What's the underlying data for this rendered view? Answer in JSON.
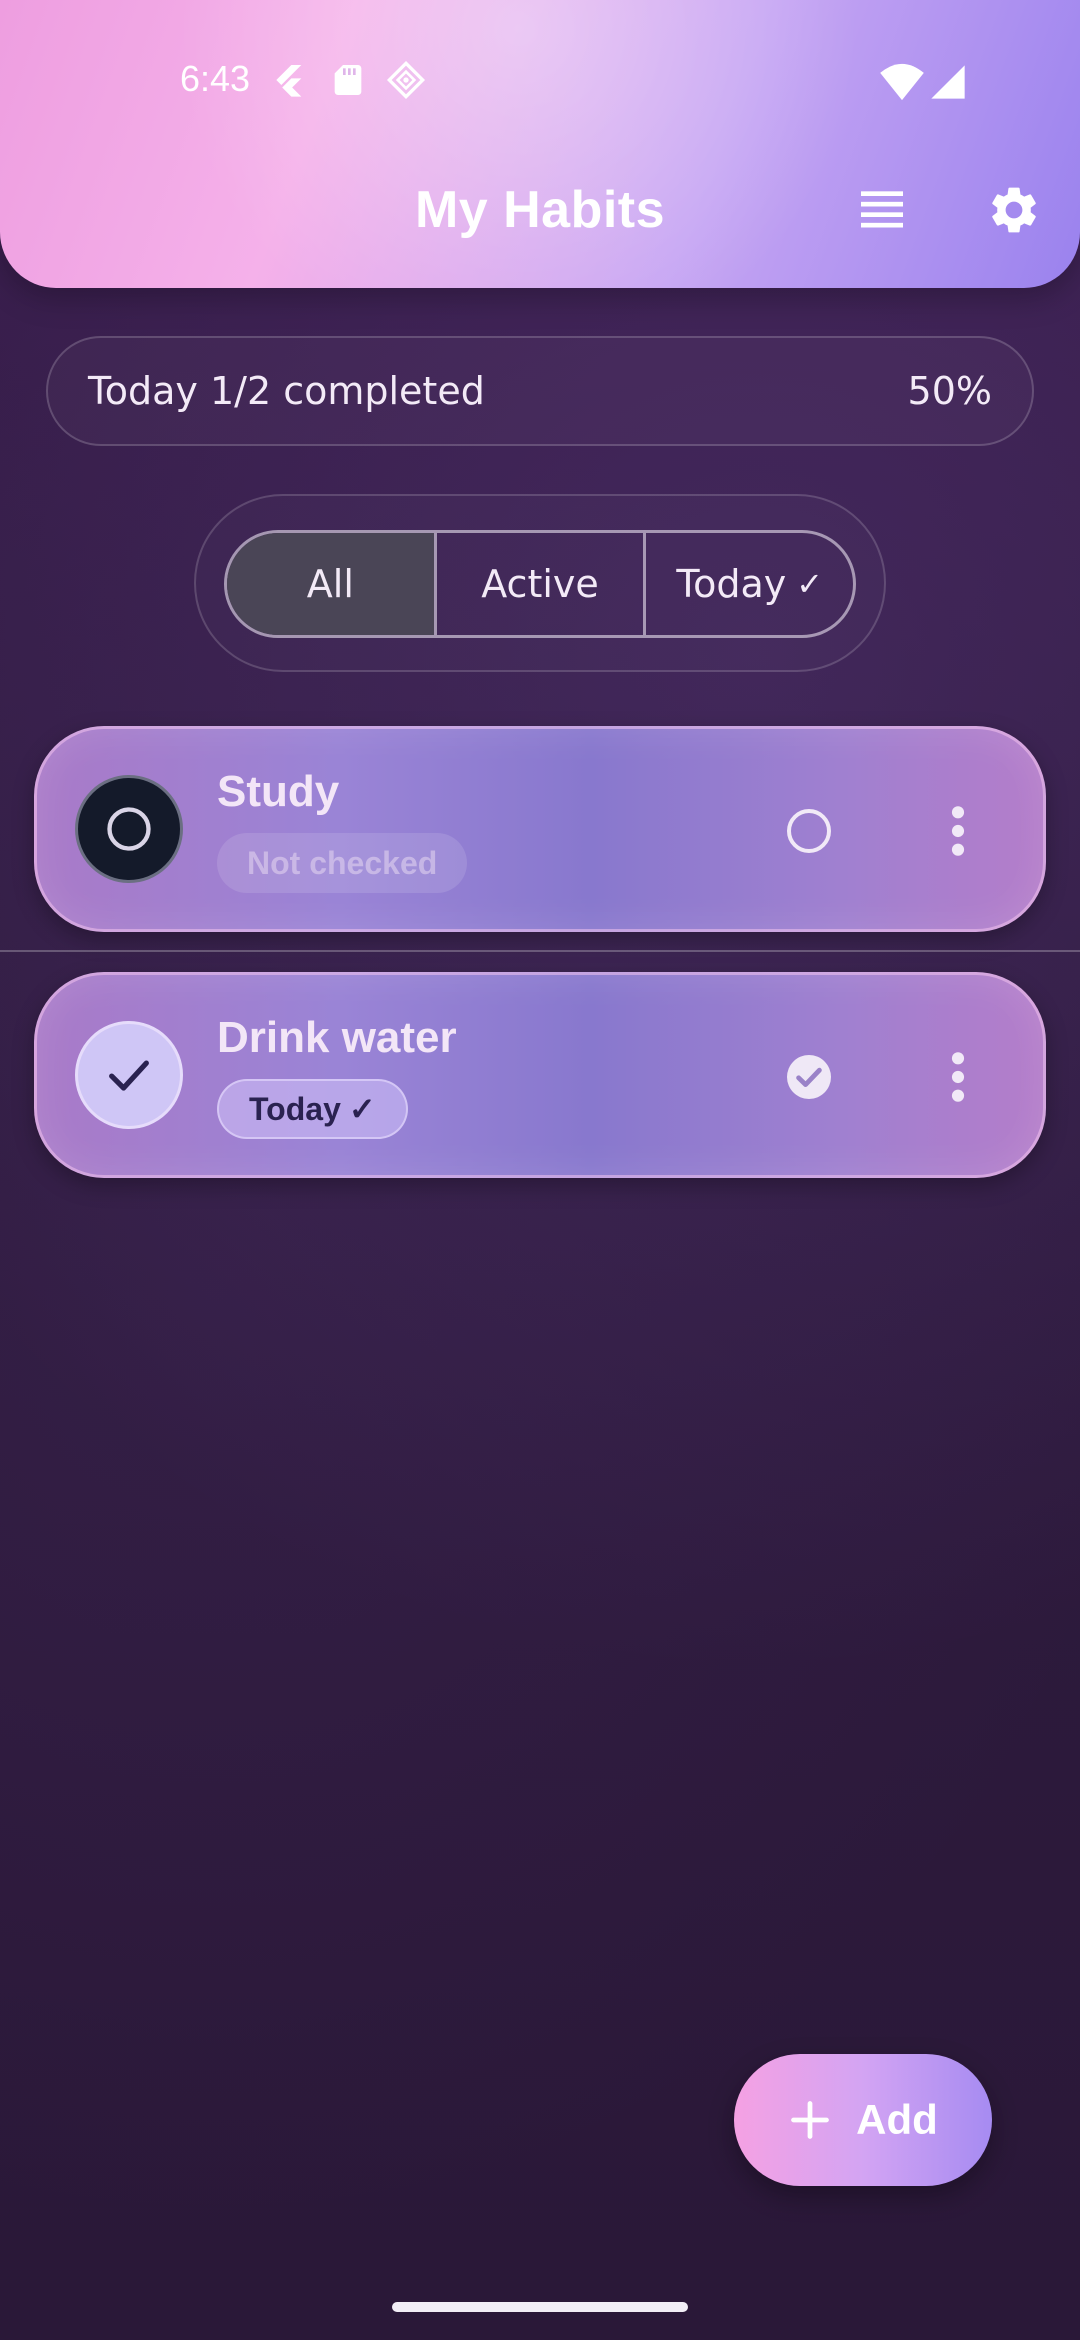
{
  "status_bar": {
    "time": "6:43",
    "icons": [
      "flutter-icon",
      "sd-card-icon",
      "diamond-icon",
      "wifi-icon",
      "cell-signal-icon"
    ]
  },
  "header": {
    "title": "My Habits",
    "actions": [
      "list-icon",
      "gear-icon"
    ]
  },
  "summary": {
    "label": "Today 1/2 completed",
    "percent": "50%"
  },
  "filters": {
    "selected": "All",
    "options": [
      {
        "label": "All"
      },
      {
        "label": "Active"
      },
      {
        "label": "Today",
        "check": "✓"
      }
    ]
  },
  "habits": [
    {
      "name": "Study",
      "status_label": "Not checked",
      "checked_today": false
    },
    {
      "name": "Drink water",
      "status_label": "Today",
      "status_check": "✓",
      "checked_today": true
    }
  ],
  "fab": {
    "label": "Add",
    "icon": "plus-icon"
  },
  "colors": {
    "background": "#2f1b3f",
    "accent_pink": "#f5a1e3",
    "accent_purple": "#a68bf2"
  }
}
